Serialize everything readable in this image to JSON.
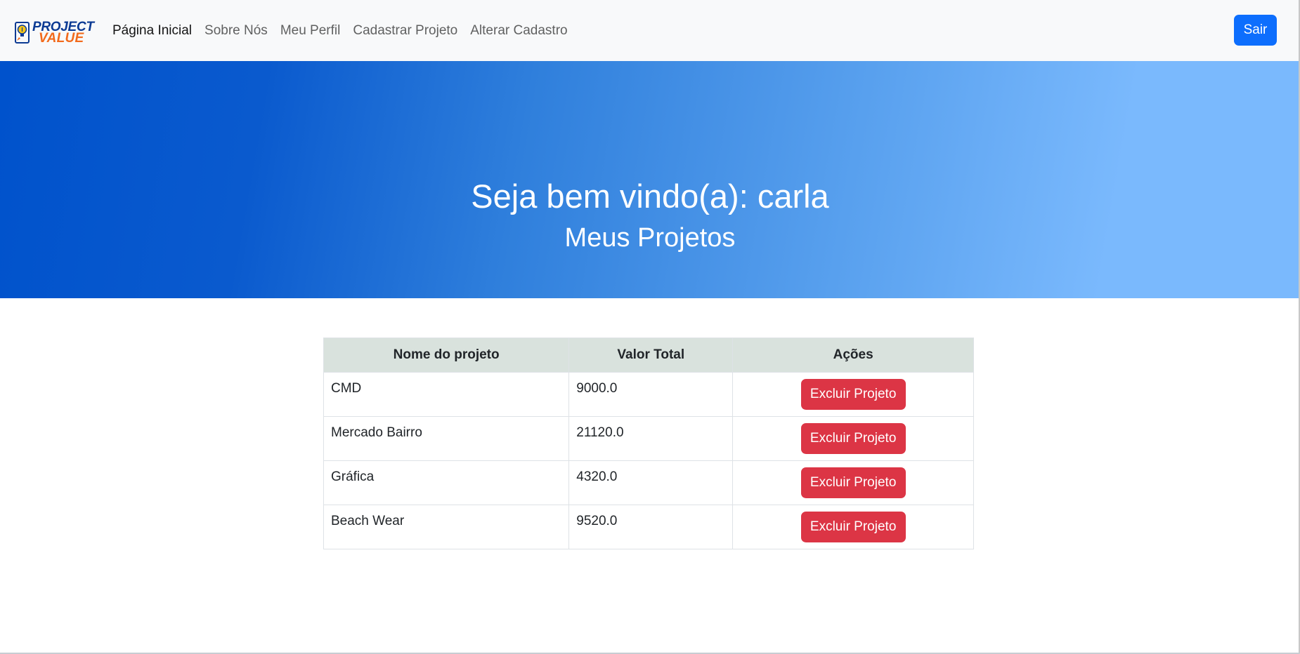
{
  "navbar": {
    "brand": {
      "line1": "PROJECT",
      "line2": "VALUE"
    },
    "links": [
      {
        "label": "Página Inicial",
        "active": true
      },
      {
        "label": "Sobre Nós",
        "active": false
      },
      {
        "label": "Meu Perfil",
        "active": false
      },
      {
        "label": "Cadastrar Projeto",
        "active": false
      },
      {
        "label": "Alterar Cadastro",
        "active": false
      }
    ],
    "logout_label": "Sair"
  },
  "hero": {
    "title": "Seja bem vindo(a): carla",
    "subtitle": "Meus Projetos"
  },
  "table": {
    "headers": [
      "Nome do projeto",
      "Valor Total",
      "Ações"
    ],
    "rows": [
      {
        "name": "CMD",
        "value": "9000.0",
        "action_label": "Excluir Projeto"
      },
      {
        "name": "Mercado Bairro",
        "value": "21120.0",
        "action_label": "Excluir Projeto"
      },
      {
        "name": "Gráfica",
        "value": "4320.0",
        "action_label": "Excluir Projeto"
      },
      {
        "name": "Beach Wear",
        "value": "9520.0",
        "action_label": "Excluir Projeto"
      }
    ]
  },
  "colors": {
    "primary": "#0d6efd",
    "danger": "#dc3545",
    "navbar_bg": "#f8f9fa",
    "table_header_bg": "#d9e2dd",
    "hero_gradient_start": "#0052cc",
    "hero_gradient_end": "#7ab9fd"
  }
}
